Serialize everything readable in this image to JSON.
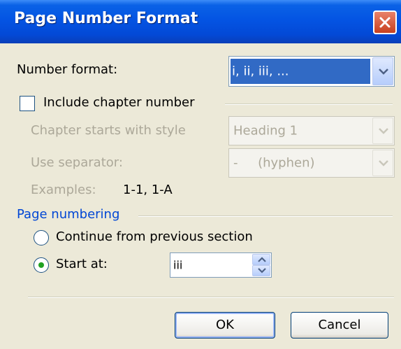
{
  "window": {
    "title": "Page Number Format"
  },
  "number_format": {
    "label": "Number format:",
    "accesskey_letter": "f",
    "value": "i, ii, iii, ..."
  },
  "include_chapter": {
    "label": "Include chapter number",
    "checked": false
  },
  "chapter_style": {
    "label": "Chapter starts with style",
    "value": "Heading 1"
  },
  "separator": {
    "label": "Use separator:",
    "value": "-     (hyphen)"
  },
  "examples": {
    "label": "Examples:",
    "value": "1-1, 1-A"
  },
  "page_numbering": {
    "label": "Page numbering",
    "continue_option": {
      "label": "Continue from previous section",
      "selected": false
    },
    "start_option": {
      "label": "Start at:",
      "selected": true
    },
    "start_value": "iii"
  },
  "buttons": {
    "ok": "OK",
    "cancel": "Cancel"
  },
  "colors": {
    "title_bar": "#0454e3",
    "close_button": "#c8401f",
    "selection": "#316ac5",
    "dialog_bg": "#ece9d8",
    "group_label": "#0046d5"
  },
  "icons": [
    "close-icon",
    "chevron-down-icon",
    "spin-up-icon",
    "spin-down-icon"
  ]
}
